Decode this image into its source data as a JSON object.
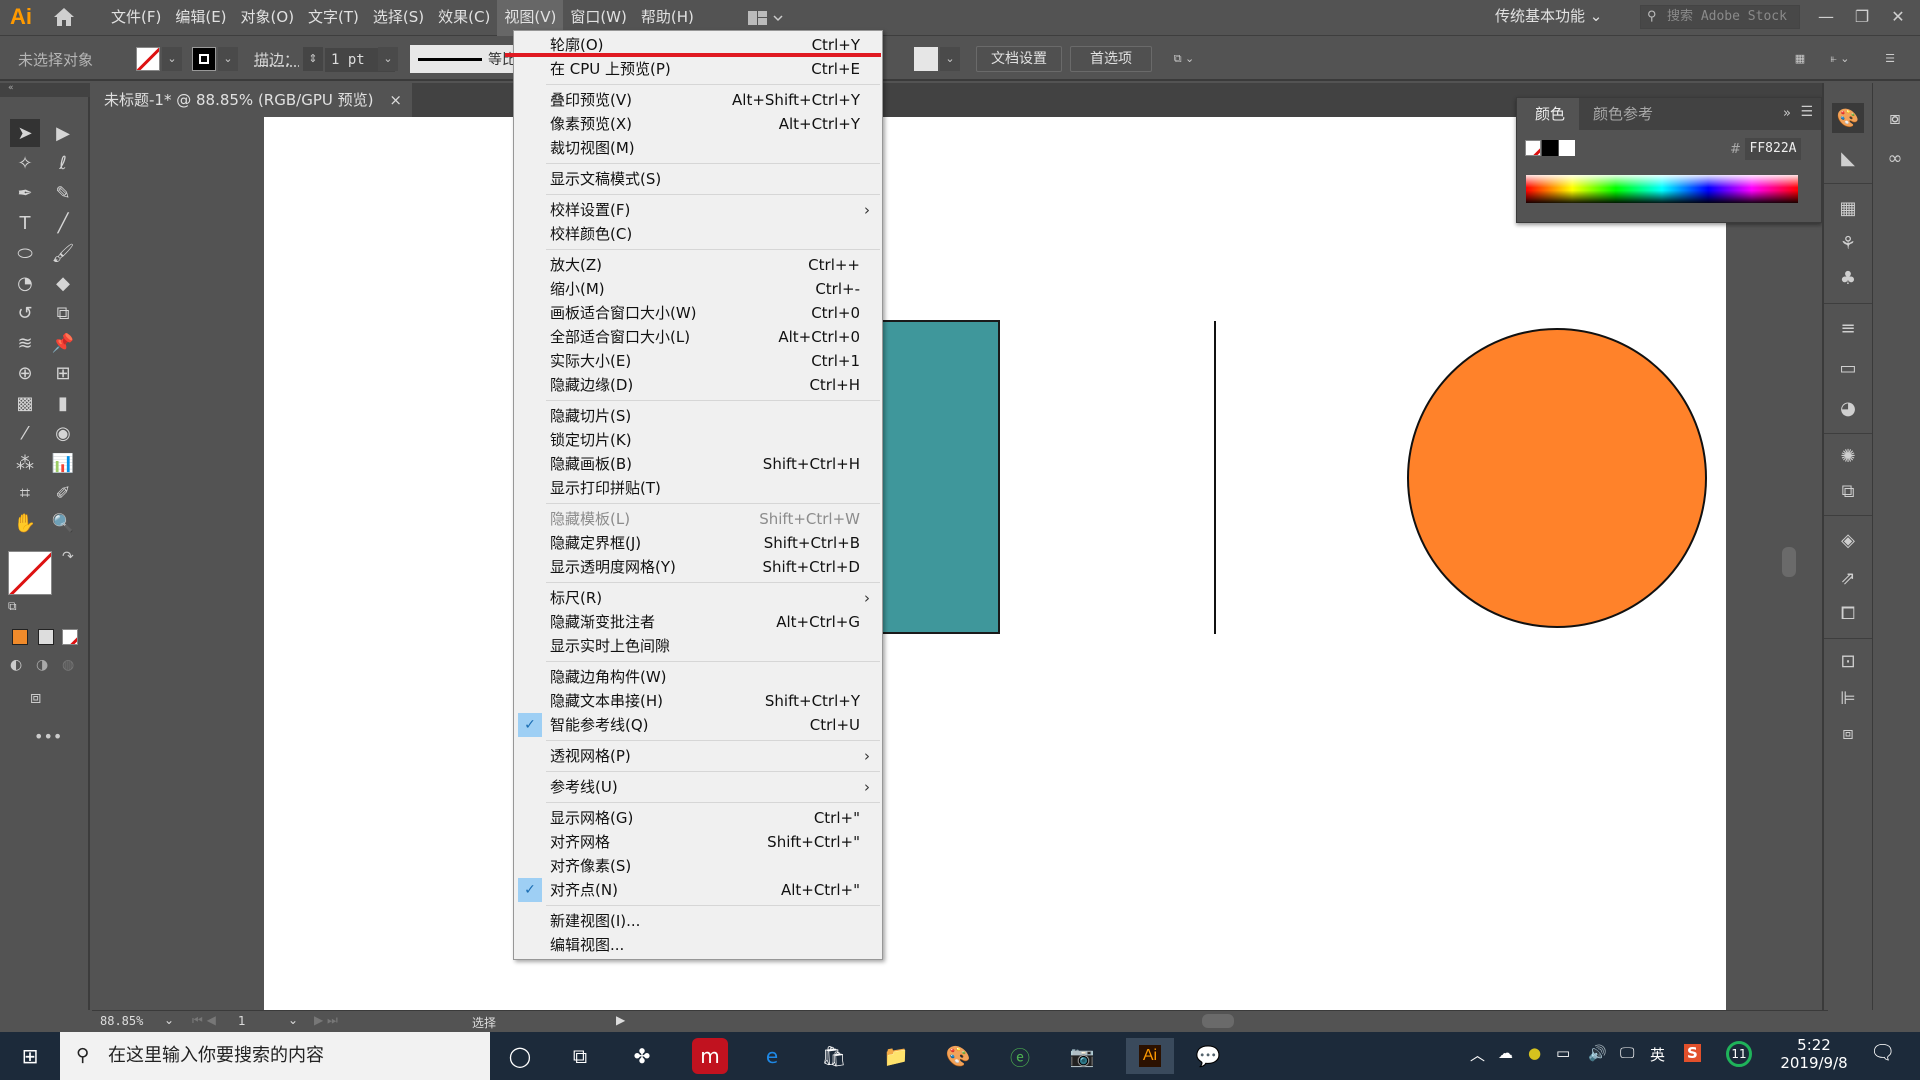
{
  "app": {
    "logo": "Ai",
    "menus": [
      "文件(F)",
      "编辑(E)",
      "对象(O)",
      "文字(T)",
      "选择(S)",
      "效果(C)",
      "视图(V)",
      "窗口(W)",
      "帮助(H)"
    ],
    "active_menu": "视图(V)",
    "workspace": "传统基本功能",
    "stock_search_placeholder": "搜索 Adobe Stock"
  },
  "control_bar": {
    "selection_status": "未选择对象",
    "stroke_label": "描边：",
    "stroke_weight": "1 pt",
    "stroke_profile": "等比",
    "doc_setup": "文档设置",
    "preferences": "首选项"
  },
  "document": {
    "tab_title": "未标题-1* @ 88.85% (RGB/GPU 预览)",
    "close": "×"
  },
  "artwork": {
    "rect_color": "#3f979b",
    "circle_color": "#FF822A",
    "stroke_color": "#111111"
  },
  "view_menu": {
    "items": [
      {
        "label": "轮廓(O)",
        "shortcut": "Ctrl+Y"
      },
      {
        "label": "在 CPU 上预览(P)",
        "shortcut": "Ctrl+E"
      },
      {
        "sep": true
      },
      {
        "label": "叠印预览(V)",
        "shortcut": "Alt+Shift+Ctrl+Y"
      },
      {
        "label": "像素预览(X)",
        "shortcut": "Alt+Ctrl+Y"
      },
      {
        "label": "裁切视图(M)",
        "shortcut": ""
      },
      {
        "sep": true
      },
      {
        "label": "显示文稿模式(S)",
        "shortcut": ""
      },
      {
        "sep": true
      },
      {
        "label": "校样设置(F)",
        "shortcut": "",
        "submenu": true
      },
      {
        "label": "校样颜色(C)",
        "shortcut": ""
      },
      {
        "sep": true
      },
      {
        "label": "放大(Z)",
        "shortcut": "Ctrl++"
      },
      {
        "label": "缩小(M)",
        "shortcut": "Ctrl+-"
      },
      {
        "label": "画板适合窗口大小(W)",
        "shortcut": "Ctrl+0"
      },
      {
        "label": "全部适合窗口大小(L)",
        "shortcut": "Alt+Ctrl+0"
      },
      {
        "label": "实际大小(E)",
        "shortcut": "Ctrl+1"
      },
      {
        "label": "隐藏边缘(D)",
        "shortcut": "Ctrl+H"
      },
      {
        "sep": true
      },
      {
        "label": "隐藏切片(S)",
        "shortcut": ""
      },
      {
        "label": "锁定切片(K)",
        "shortcut": ""
      },
      {
        "label": "隐藏画板(B)",
        "shortcut": "Shift+Ctrl+H"
      },
      {
        "label": "显示打印拼贴(T)",
        "shortcut": ""
      },
      {
        "sep": true
      },
      {
        "label": "隐藏模板(L)",
        "shortcut": "Shift+Ctrl+W",
        "disabled": true
      },
      {
        "label": "隐藏定界框(J)",
        "shortcut": "Shift+Ctrl+B"
      },
      {
        "label": "显示透明度网格(Y)",
        "shortcut": "Shift+Ctrl+D"
      },
      {
        "sep": true
      },
      {
        "label": "标尺(R)",
        "shortcut": "",
        "submenu": true
      },
      {
        "label": "隐藏渐变批注者",
        "shortcut": "Alt+Ctrl+G"
      },
      {
        "label": "显示实时上色间隙",
        "shortcut": ""
      },
      {
        "sep": true
      },
      {
        "label": "隐藏边角构件(W)",
        "shortcut": ""
      },
      {
        "label": "隐藏文本串接(H)",
        "shortcut": "Shift+Ctrl+Y"
      },
      {
        "label": "智能参考线(Q)",
        "shortcut": "Ctrl+U",
        "checked": true
      },
      {
        "sep": true
      },
      {
        "label": "透视网格(P)",
        "shortcut": "",
        "submenu": true
      },
      {
        "sep": true
      },
      {
        "label": "参考线(U)",
        "shortcut": "",
        "submenu": true
      },
      {
        "sep": true
      },
      {
        "label": "显示网格(G)",
        "shortcut": "Ctrl+\""
      },
      {
        "label": "对齐网格",
        "shortcut": "Shift+Ctrl+\""
      },
      {
        "label": "对齐像素(S)",
        "shortcut": ""
      },
      {
        "label": "对齐点(N)",
        "shortcut": "Alt+Ctrl+\"",
        "checked": true
      },
      {
        "sep": true
      },
      {
        "label": "新建视图(I)...",
        "shortcut": ""
      },
      {
        "label": "编辑视图...",
        "shortcut": ""
      }
    ]
  },
  "color_panel": {
    "tab_active": "颜色",
    "tab_other": "颜色参考",
    "hex_label": "#",
    "hex_value": "FF822A"
  },
  "status_bar": {
    "zoom": "88.85%",
    "artboard": "1",
    "tool": "选择"
  },
  "taskbar": {
    "search_placeholder": "在这里输入你要搜索的内容",
    "ime": "英",
    "badge": "11",
    "time": "5:22",
    "date": "2019/9/8"
  }
}
